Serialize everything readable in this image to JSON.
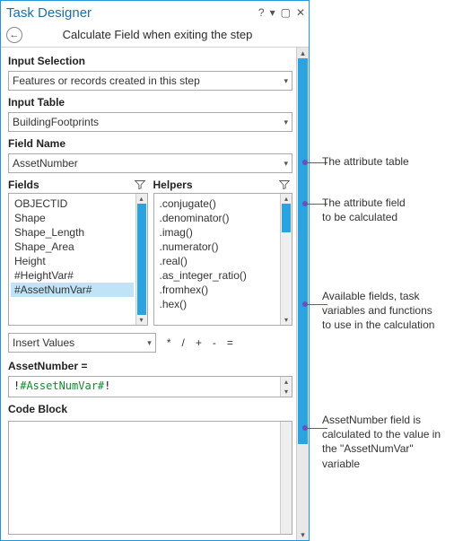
{
  "window": {
    "title": "Task Designer",
    "subtitle": "Calculate Field when exiting the step"
  },
  "inputSelection": {
    "label": "Input Selection",
    "value": "Features or records created in this step"
  },
  "inputTable": {
    "label": "Input Table",
    "value": "BuildingFootprints"
  },
  "fieldName": {
    "label": "Field Name",
    "value": "AssetNumber"
  },
  "fieldsPanel": {
    "label": "Fields",
    "items": [
      "OBJECTID",
      "Shape",
      "Shape_Length",
      "Shape_Area",
      "Height",
      "#HeightVar#",
      "#AssetNumVar#"
    ],
    "selected": "#AssetNumVar#"
  },
  "helpersPanel": {
    "label": "Helpers",
    "items": [
      ".conjugate()",
      ".denominator()",
      ".imag()",
      ".numerator()",
      ".real()",
      ".as_integer_ratio()",
      ".fromhex()",
      ".hex()"
    ]
  },
  "insertValues": {
    "value": "Insert Values",
    "ops": [
      "*",
      "/",
      "+",
      "-",
      "="
    ]
  },
  "expression": {
    "label": "AssetNumber =",
    "value_prefix": "!",
    "value_mark": "#AssetNumVar#",
    "value_suffix": "!"
  },
  "codeBlock": {
    "label": "Code Block"
  },
  "annotations": {
    "a1": "The attribute table",
    "a2": "The attribute field\nto be calculated",
    "a3": "Available fields, task\nvariables and functions\nto use in the calculation",
    "a4": "AssetNumber field is\ncalculated to the value in\nthe \"AssetNumVar\" variable"
  }
}
